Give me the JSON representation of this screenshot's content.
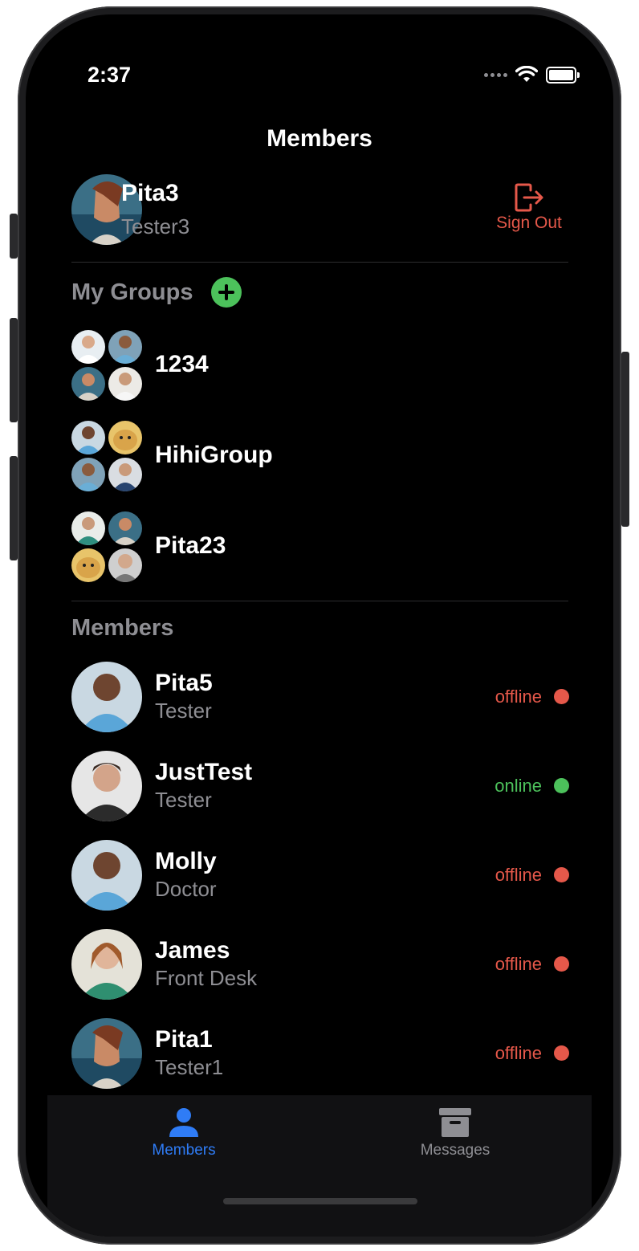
{
  "status_bar": {
    "time": "2:37"
  },
  "nav": {
    "title": "Members"
  },
  "current_user": {
    "name": "Pita3",
    "role": "Tester3",
    "sign_out_label": "Sign Out"
  },
  "groups_section": {
    "title": "My Groups",
    "groups": [
      {
        "name": "1234"
      },
      {
        "name": "HihiGroup"
      },
      {
        "name": "Pita23"
      }
    ]
  },
  "members_section": {
    "title": "Members",
    "members": [
      {
        "name": "Pita5",
        "role": "Tester",
        "status": "offline"
      },
      {
        "name": "JustTest",
        "role": "Tester",
        "status": "online"
      },
      {
        "name": "Molly",
        "role": "Doctor",
        "status": "offline"
      },
      {
        "name": "James",
        "role": "Front Desk",
        "status": "offline"
      },
      {
        "name": "Pita1",
        "role": "Tester1",
        "status": "offline"
      }
    ]
  },
  "tabbar": {
    "members_label": "Members",
    "messages_label": "Messages"
  },
  "colors": {
    "accent": "#2f7cf6",
    "danger": "#e5584a",
    "online": "#4cc15b",
    "secondary_text": "#8e8e93"
  }
}
